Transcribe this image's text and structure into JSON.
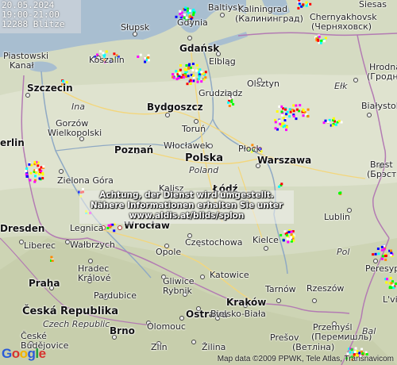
{
  "infobox": {
    "date": "20.05.2024",
    "time_range": "19:00-21:00",
    "strike_count": "12288 Blitze"
  },
  "notice": {
    "line1": "Achtung, der Dienst wird umgestellt.",
    "line2": "Nähere Informationen erhalten Sie unter",
    "line3": "www.aldis.at/blids/splon"
  },
  "map_labels": {
    "baltiysk": "Baltiysk",
    "kaliningrad": "Kaliningrad",
    "kaliningrad_cyr": "(Калининград)",
    "chernyakhovsk": "Chernyakhovsk",
    "chernyakhovsk_cyr": "(Черняховск)",
    "siesas": "Siesas",
    "gdynia": "Gdynia",
    "slupsk": "Słupsk",
    "gdansk": "Gdańsk",
    "elblag": "Elbląg",
    "piastowski": "Piastowski",
    "kanal": "Kanał",
    "koszalin": "Koszalin",
    "szczecin": "Szczecin",
    "ina": "Ina",
    "olsztyn": "Olsztyn",
    "hrodna": "Hrodna",
    "hrodna_cyr": "(Гродна)",
    "elk": "Ełk",
    "grudziadz": "Grudziądz",
    "bydgoszcz": "Bydgoszcz",
    "bialystok": "Białystok",
    "torun": "Toruń",
    "gorzow": "Gorzów",
    "wielkopolski": "Wielkopolski",
    "erlin": "erlin",
    "poznan": "Poznań",
    "wloclawek": "Włocławek",
    "plock": "Płock",
    "polska": "Polska",
    "poland": "Poland",
    "warszawa": "Warszawa",
    "brest": "Brest",
    "brest_cyr": "(Брэст)",
    "zielona_gora": "Zielona Góra",
    "kalisz": "Kalisz",
    "lodz": "Łódź",
    "lublin": "Lublin",
    "legnica": "Legnica",
    "wroclaw": "Wrocław",
    "dresden": "Dresden",
    "liberec": "Liberec",
    "walbrzych": "Wałbrzych",
    "opole": "Opole",
    "czestochowa": "Częstochowa",
    "kielce": "Kielce",
    "pol": "Pol",
    "hradec": "Hradec",
    "kralove": "Králové",
    "gliwice": "Gliwice",
    "katowice": "Katowice",
    "peresyp": "Peresyp",
    "praha": "Praha",
    "pardubice": "Pardubice",
    "rybnik": "Rybnik",
    "tarnow": "Tarnów",
    "rzeszow": "Rzeszów",
    "krakow": "Kraków",
    "lviv": "L'viv",
    "ostrava": "Ostrava",
    "bielsko_biala": "Bielsko-Biała",
    "ceska_republika": "Česká Republika",
    "czech_republic": "Czech Republic",
    "olomouc": "Olomouc",
    "przemysl": "Przemyśl",
    "peremyshl": "(Перемишль)",
    "brno": "Brno",
    "budejovice": "Budějovice",
    "zlin": "Zlín",
    "zilina": "Žilina",
    "presov": "Prešov",
    "vetlina": "(Ветліна)",
    "ceske": "České",
    "bal": "Bal"
  },
  "google_logo": "Google",
  "credit": "Map data ©2009 PPWK, Tele Atlas, Transnavicom"
}
